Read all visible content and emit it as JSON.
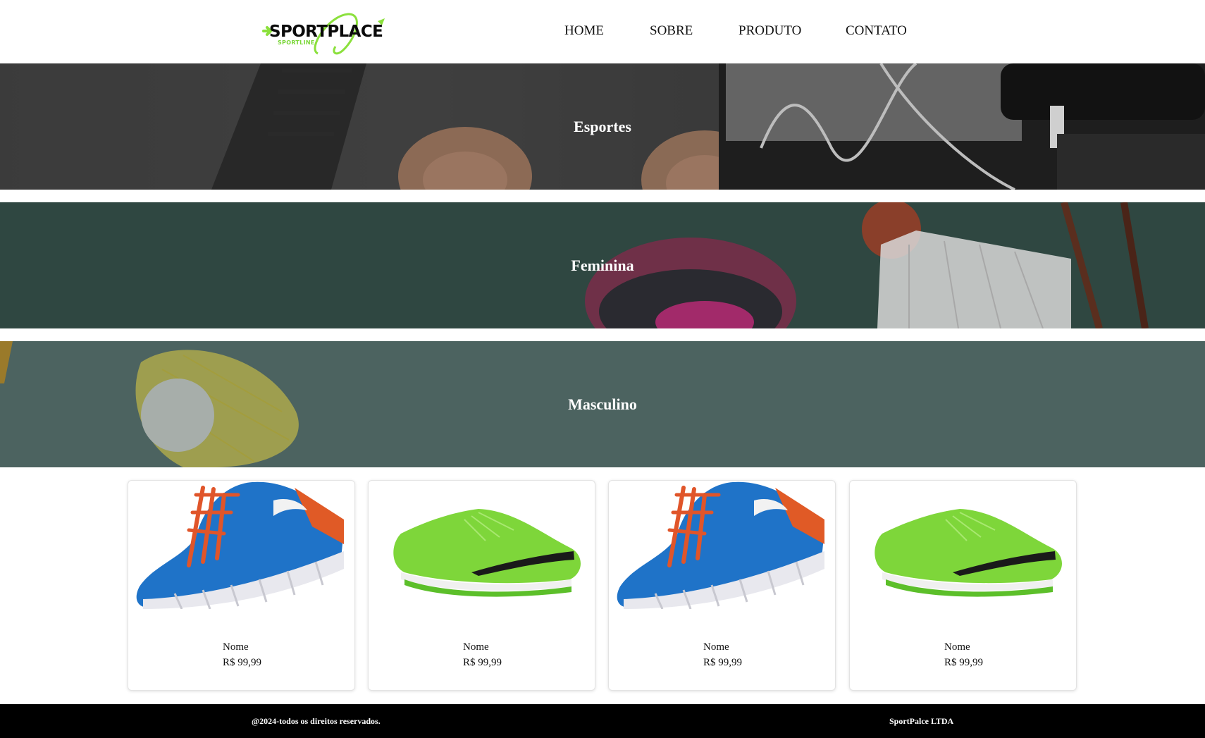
{
  "brand": {
    "name": "SPORTPLACE",
    "tagline": "SPORTLINE",
    "accent_color": "#8be03c"
  },
  "nav": {
    "items": [
      {
        "label": "HOME"
      },
      {
        "label": "SOBRE"
      },
      {
        "label": "PRODUTO"
      },
      {
        "label": "CONTATO"
      }
    ]
  },
  "banners": [
    {
      "title": "Esportes"
    },
    {
      "title": "Feminina"
    },
    {
      "title": "Masculino"
    }
  ],
  "products": [
    {
      "name": "Nome",
      "price": "R$ 99,99",
      "image": "blue-running-shoe"
    },
    {
      "name": "Nome",
      "price": "R$ 99,99",
      "image": "green-soccer-shoe"
    },
    {
      "name": "Nome",
      "price": "R$ 99,99",
      "image": "blue-running-shoe"
    },
    {
      "name": "Nome",
      "price": "R$ 99,99",
      "image": "green-soccer-shoe"
    }
  ],
  "footer": {
    "copyright": "@2024-todos os direitos reservados.",
    "company": "SportPalce LTDA"
  }
}
